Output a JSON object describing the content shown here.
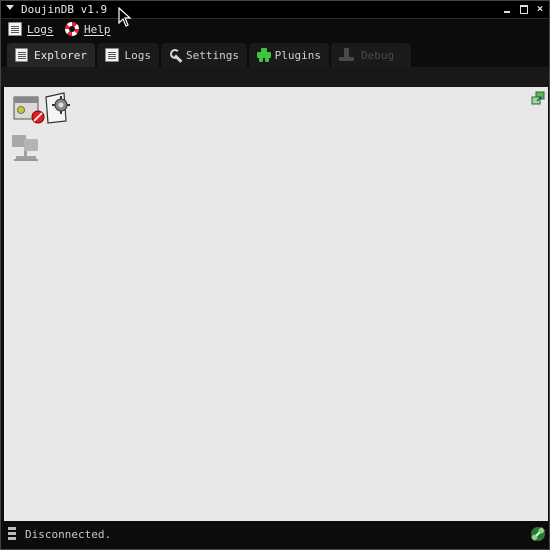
{
  "window": {
    "title": "DoujinDB v1.9",
    "controls": [
      "minimize-icon",
      "maximize-icon",
      "close-icon"
    ],
    "close_glyph": "×"
  },
  "menubar": {
    "items": [
      {
        "label": "Logs",
        "icon": "document-icon"
      },
      {
        "label": "Help",
        "icon": "lifebuoy-icon"
      }
    ]
  },
  "tabs": [
    {
      "label": "Explorer",
      "icon": "document-icon",
      "active": true
    },
    {
      "label": "Logs",
      "icon": "document-icon",
      "active": false
    },
    {
      "label": "Settings",
      "icon": "wrench-icon",
      "active": false
    },
    {
      "label": "Plugins",
      "icon": "puzzle-icon",
      "active": false
    },
    {
      "label": "Debug",
      "icon": "joystick-icon",
      "active": false,
      "disabled": true
    }
  ],
  "explorer": {
    "icons": [
      "database-blocked-icon",
      "network-disconnected-icon",
      "window-restore-icon"
    ]
  },
  "statusbar": {
    "text": "Disconnected.",
    "icons": [
      "server-icon",
      "connection-icon"
    ]
  },
  "colors": {
    "background": "#0c0c0c",
    "content": "#e8e8e8",
    "accent_green": "#3ec43e",
    "accent_red": "#e02020"
  }
}
